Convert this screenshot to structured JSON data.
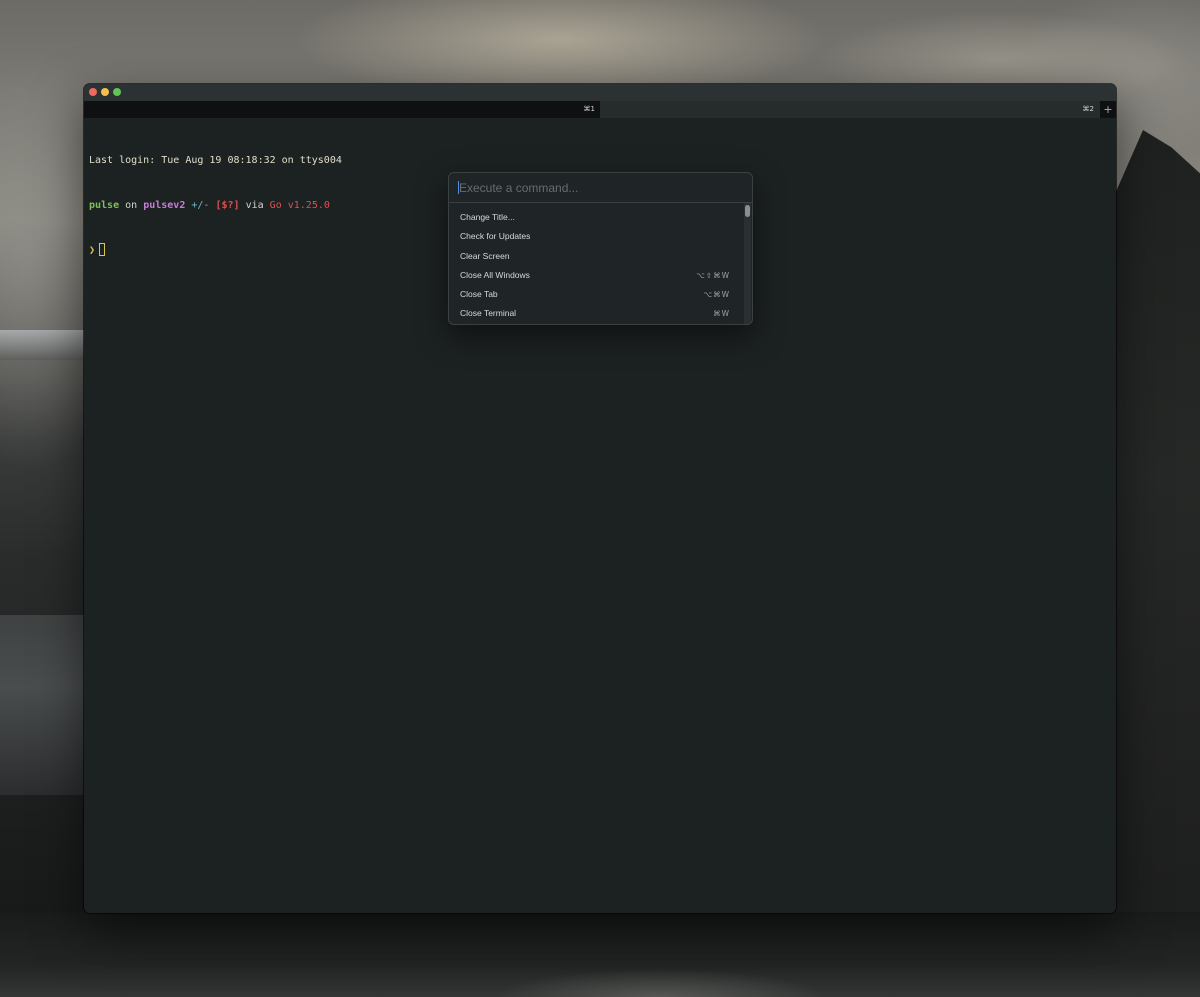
{
  "tabs": [
    {
      "shortcut": "⌘1",
      "active": true
    },
    {
      "shortcut": "⌘2",
      "active": false
    }
  ],
  "new_tab_label": "+",
  "terminal": {
    "login_line": "Last login: Tue Aug 19 08:18:32 on ttys004",
    "prompt": {
      "dir": "pulse",
      "on": " on ",
      "branch_icon": "",
      "branch": "pulsev2",
      "changes": " +/-",
      "status": " [$?]",
      "via": " via ",
      "go_version": "Go v1.25.0"
    },
    "prompt_symbol": "❯"
  },
  "command_palette": {
    "placeholder": "Execute a command...",
    "items": [
      {
        "label": "Change Title...",
        "shortcut": ""
      },
      {
        "label": "Check for Updates",
        "shortcut": ""
      },
      {
        "label": "Clear Screen",
        "shortcut": ""
      },
      {
        "label": "Close All Windows",
        "shortcut": "⌥⇧⌘W"
      },
      {
        "label": "Close Tab",
        "shortcut": "⌥⌘W"
      },
      {
        "label": "Close Terminal",
        "shortcut": "⌘W"
      }
    ]
  },
  "colors": {
    "terminal_background": "#1c2122",
    "prompt_green": "#7fc05a",
    "prompt_purple": "#c77dd6",
    "prompt_red": "#e14f4f",
    "prompt_yellow": "#d9c64e",
    "caret_blue": "#4f8fe0"
  }
}
